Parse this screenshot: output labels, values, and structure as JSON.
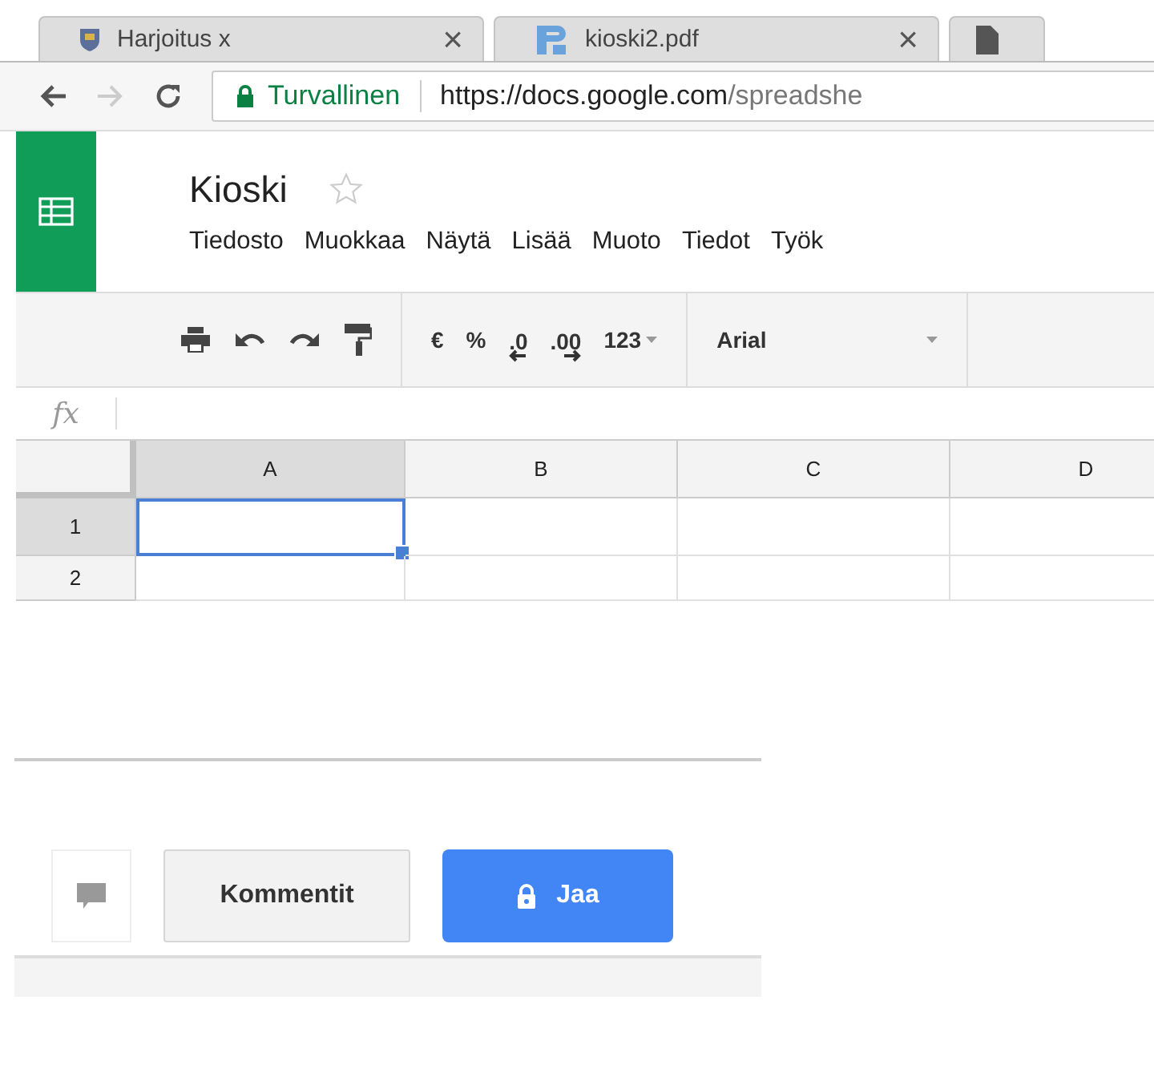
{
  "browser": {
    "tabs": [
      {
        "kind": "crest",
        "title": "Harjoitus x",
        "close": "×"
      },
      {
        "kind": "pdf",
        "title": "kioski2.pdf",
        "close": "×"
      },
      {
        "kind": "file"
      }
    ],
    "security_label": "Turvallinen",
    "url_host": "https://docs.google.com",
    "url_path": "/spreadshe"
  },
  "document": {
    "title": "Kioski",
    "starred": false,
    "menu": [
      "Tiedosto",
      "Muokkaa",
      "Näytä",
      "Lisää",
      "Muoto",
      "Tiedot",
      "Työk"
    ]
  },
  "toolbar": {
    "currency": "€",
    "percent": "%",
    "decrease_decimals": ".0",
    "increase_decimals": ".00",
    "number_format": "123",
    "font": "Arial"
  },
  "formula_bar": {
    "label": "fx"
  },
  "sheet": {
    "columns": [
      {
        "label": "A",
        "selected": true
      },
      {
        "label": "B",
        "selected": false
      },
      {
        "label": "C",
        "selected": false
      },
      {
        "label": "D",
        "selected": false
      }
    ],
    "rows": [
      {
        "label": "1",
        "selected": true
      },
      {
        "label": "2",
        "selected": false
      }
    ]
  },
  "actions": {
    "comments": "Kommentit",
    "share": "Jaa"
  }
}
